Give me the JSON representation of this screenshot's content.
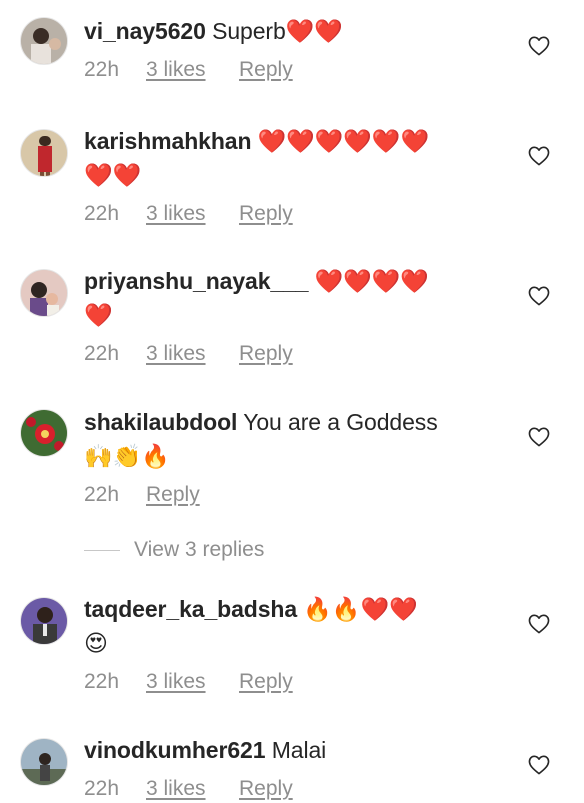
{
  "comments": [
    {
      "username": "vi_nay5620",
      "text": "Superb",
      "emojis": "❤️❤️",
      "line2": "",
      "time": "22h",
      "likes": "3 likes",
      "reply": "Reply",
      "avatar_color": "#b9b1a7"
    },
    {
      "username": "karishmahkhan",
      "text": "",
      "emojis": "❤️❤️❤️❤️❤️❤️",
      "line2": "❤️❤️",
      "time": "22h",
      "likes": "3 likes",
      "reply": "Reply",
      "avatar_color": "#c4a77a"
    },
    {
      "username": "priyanshu_nayak___",
      "text": "",
      "emojis": "❤️❤️❤️❤️",
      "line2": "❤️",
      "time": "22h",
      "likes": "3 likes",
      "reply": "Reply",
      "avatar_color": "#c9a8a0"
    },
    {
      "username": "shakilaubdool",
      "text": "You are a Goddess",
      "emojis": "",
      "line2": "🙌👏🔥",
      "time": "22h",
      "likes": "",
      "reply": "Reply",
      "avatar_color": "#3f6b32"
    },
    {
      "username": "taqdeer_ka_badsha",
      "text": "",
      "emojis": "🔥🔥❤️❤️",
      "line2": "😍",
      "time": "22h",
      "likes": "3 likes",
      "reply": "Reply",
      "avatar_color": "#6b5aa6"
    },
    {
      "username": "vinodkumher621",
      "text": "Malai",
      "emojis": "",
      "line2": "",
      "time": "22h",
      "likes": "3 likes",
      "reply": "Reply",
      "avatar_color": "#7a8c9b"
    }
  ],
  "view_replies": "View 3 replies",
  "colors": {
    "text": "#262626",
    "meta": "#8e8e8e",
    "heart": "#ed2a2a"
  },
  "icons": {
    "like": "heart-outline-icon"
  }
}
